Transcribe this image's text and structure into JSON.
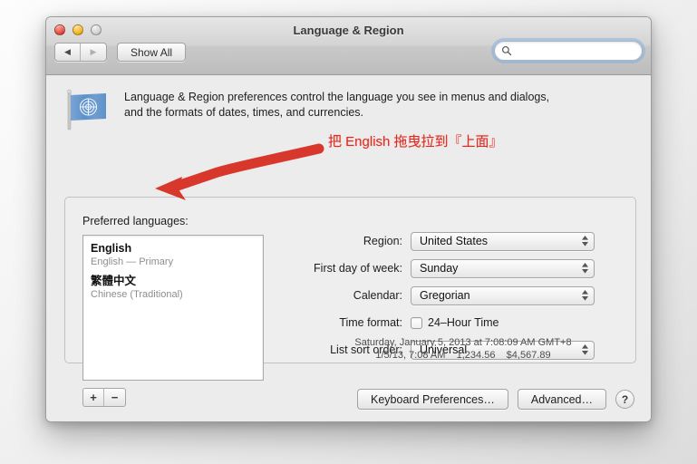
{
  "window": {
    "title": "Language & Region",
    "traffic_lights": [
      "close",
      "minimize",
      "zoom"
    ],
    "nav_back": "◀",
    "nav_forward": "▶",
    "show_all_label": "Show All",
    "search": {
      "value": "",
      "placeholder": ""
    }
  },
  "intro": {
    "icon": "un-flag-icon",
    "line1": "Language & Region preferences control the language you see in menus and dialogs,",
    "line2": "and the formats of dates, times, and currencies."
  },
  "preferred": {
    "label": "Preferred languages:",
    "languages": [
      {
        "name": "English",
        "sub": "English — Primary"
      },
      {
        "name": "繁體中文",
        "sub": "Chinese (Traditional)"
      }
    ],
    "add_label": "+",
    "remove_label": "−"
  },
  "form": {
    "rows": [
      {
        "label": "Region:",
        "value": "United States"
      },
      {
        "label": "First day of week:",
        "value": "Sunday"
      },
      {
        "label": "Calendar:",
        "value": "Gregorian"
      }
    ],
    "time_format": {
      "label": "Time format:",
      "checkbox_label": "24–Hour Time",
      "checked": false
    },
    "sort_order": {
      "label": "List sort order:",
      "value": "Universal"
    }
  },
  "samples": {
    "line1": "Saturday, January 5, 2013 at 7:08:09 AM GMT+8",
    "line2": "1/5/13, 7:08 AM    1,234.56    $4,567.89"
  },
  "footer": {
    "keyboard_prefs_label": "Keyboard Preferences…",
    "advanced_label": "Advanced…",
    "help_label": "?"
  },
  "annotation": {
    "text": "把 English 拖曳拉到『上面』",
    "color": "#e22b20"
  }
}
